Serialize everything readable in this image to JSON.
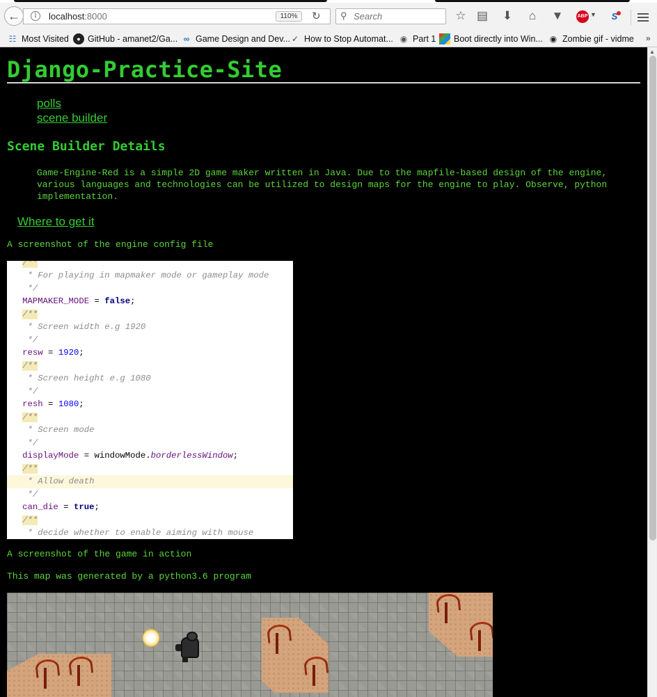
{
  "browser": {
    "url_host": "localhost",
    "url_port": ":8000",
    "zoom": "110%",
    "search_placeholder": "Search",
    "bookmarks": [
      {
        "label": "Most Visited",
        "icon": "most-visited-icon"
      },
      {
        "label": "GitHub - amanet2/Ga...",
        "icon": "github-icon"
      },
      {
        "label": "Game Design and Dev...",
        "icon": "link-icon"
      },
      {
        "label": "How to Stop Automat...",
        "icon": "tool-icon"
      },
      {
        "label": "Part 1",
        "icon": "globe-icon"
      },
      {
        "label": "Boot directly into Win...",
        "icon": "windows-flag-icon"
      },
      {
        "label": "Zombie gif - vidme",
        "icon": "eye-icon"
      }
    ],
    "colors": {
      "accent_green": "#33cc33",
      "text_green": "#5bd63a",
      "background": "#000000",
      "abp_red": "#d7001c"
    }
  },
  "site": {
    "title": "Django-Practice-Site",
    "nav": [
      {
        "label": "polls"
      },
      {
        "label": "scene builder"
      }
    ]
  },
  "content": {
    "heading": "Scene Builder Details",
    "description": "Game-Engine-Red is a simple 2D game maker written in Java. Due to the mapfile-based design of the engine, various languages and technologies can be utilized to design maps for the engine to play. Observe, python implementation.",
    "get_link": "Where to get it",
    "caption_config": "A screenshot of the engine config file",
    "caption_game": "A screenshot of the game in action",
    "caption_map": "This map was generated by a python3.6 program"
  },
  "config_code": {
    "comment_open": "/**",
    "comment_close": "*/",
    "c_mapmaker": "* For playing in mapmaker mode or gameplay mode",
    "v_mapmaker": "MAPMAKER_MODE",
    "val_mapmaker": "false",
    "c_resw": "* Screen width e.g 1920",
    "v_resw": "resw",
    "val_resw": "1920",
    "c_resh": "* Screen height e.g 1080",
    "v_resh": "resh",
    "val_resh": "1080",
    "c_mode": "* Screen mode",
    "v_mode": "displayMode",
    "val_mode_cls": "windowMode.",
    "val_mode_enum": "borderlessWindow",
    "c_death": "* Allow death",
    "v_death": "can_die",
    "val_death": "true",
    "c_aim": "* decide whether to enable aiming with mouse"
  }
}
